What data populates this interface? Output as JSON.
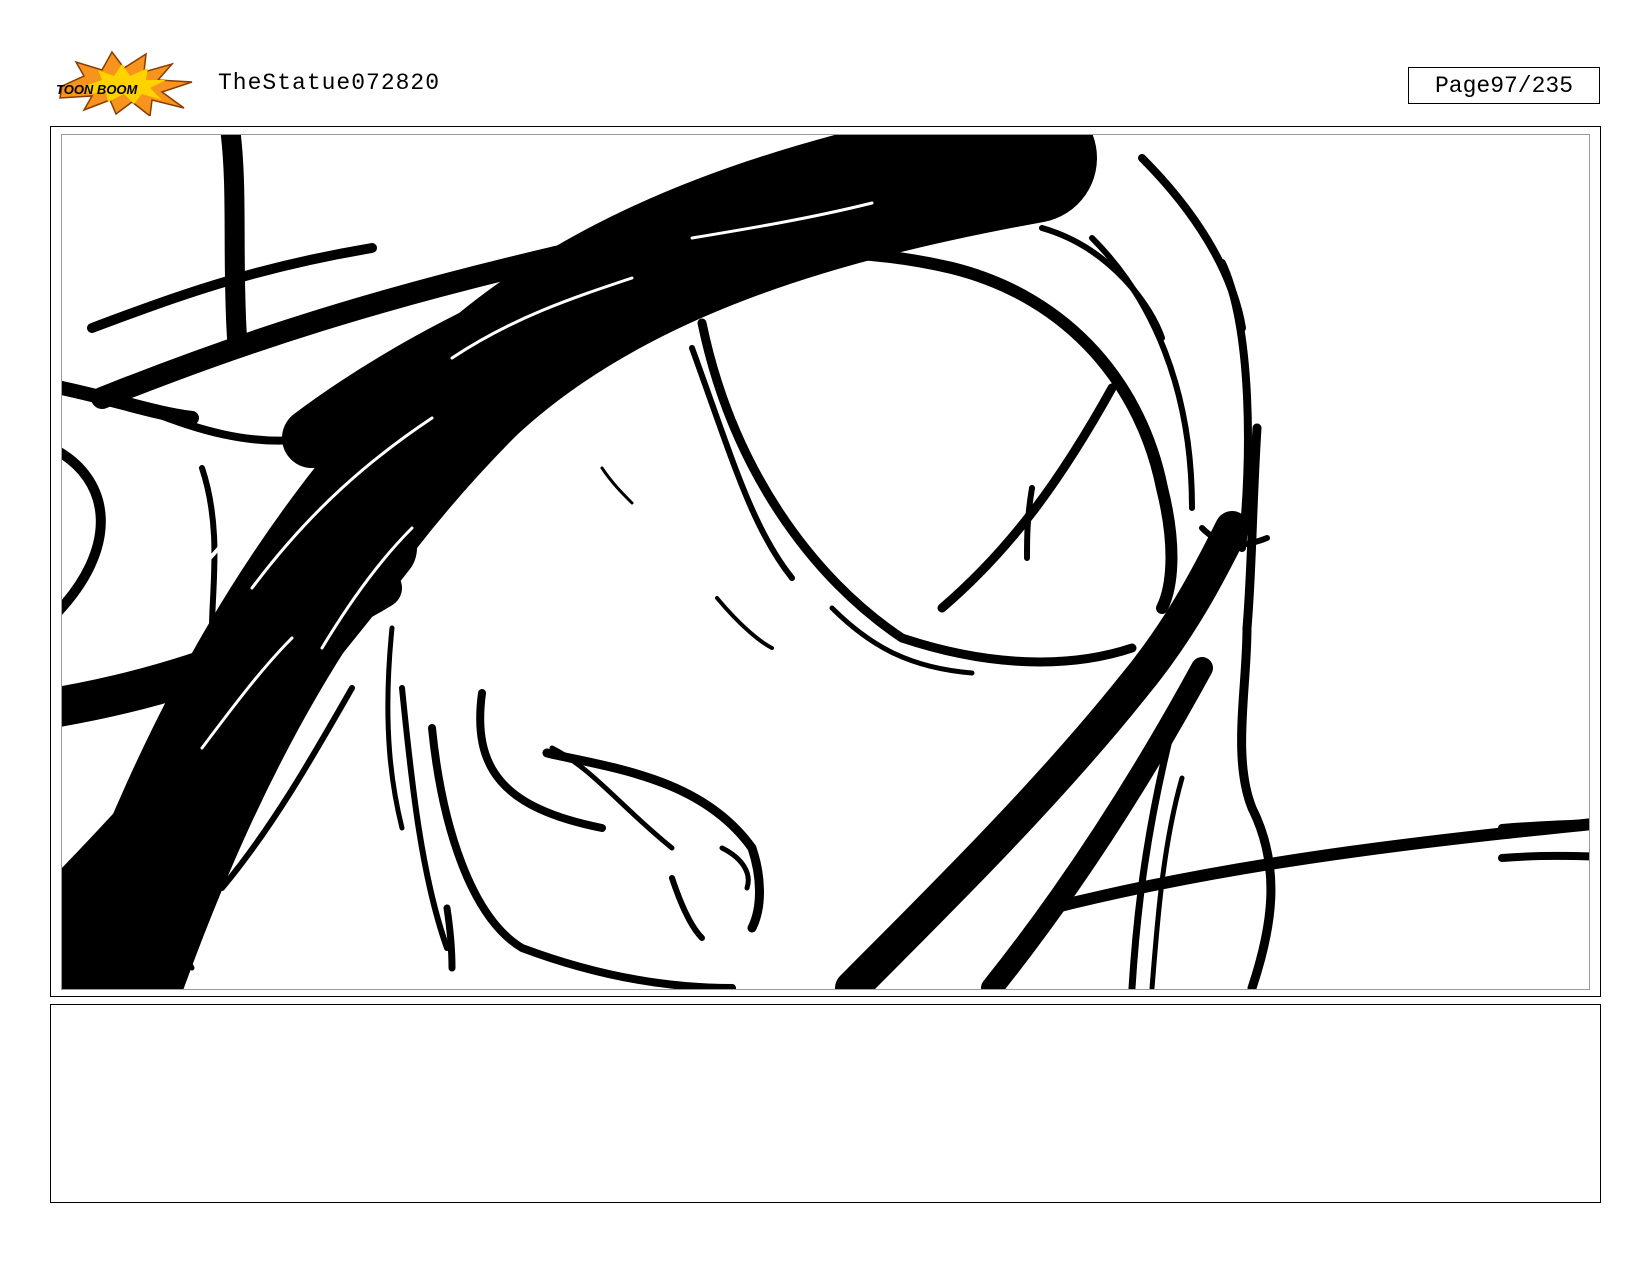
{
  "header": {
    "logo_text": "TOON BOOM",
    "title": "TheStatue072820",
    "page_label": "Page",
    "page_number": "97/235"
  },
  "panel": {
    "notes_text": ""
  },
  "colors": {
    "logo_burst_orange": "#f7941d",
    "logo_burst_yellow": "#ffd200",
    "ink": "#000000",
    "panel_inner_border": "#9a9a9a"
  }
}
